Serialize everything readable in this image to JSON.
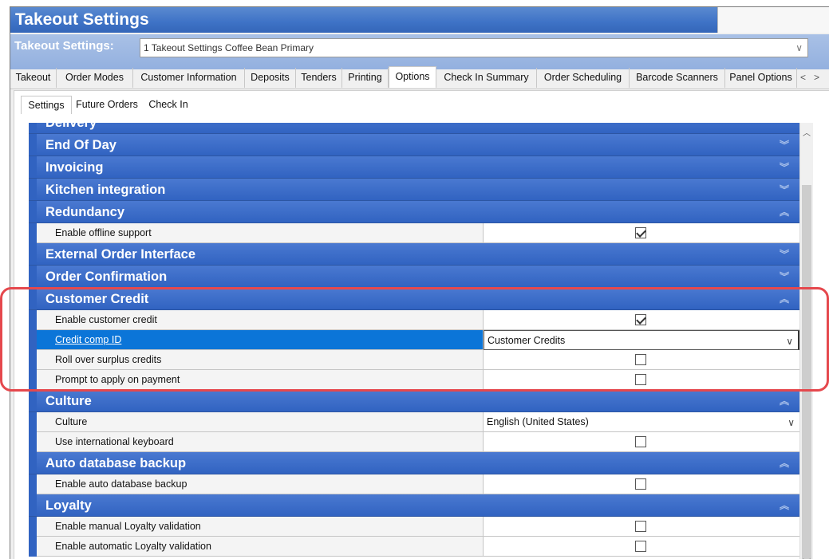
{
  "window": {
    "title": "Takeout Settings"
  },
  "selector": {
    "label": "Takeout Settings:",
    "value": "1 Takeout Settings Coffee Bean Primary"
  },
  "tabs": [
    "Takeout",
    "Order Modes",
    "Customer Information",
    "Deposits",
    "Tenders",
    "Printing",
    "Options",
    "Check In Summary",
    "Order Scheduling",
    "Barcode Scanners",
    "Panel Options"
  ],
  "active_tab": "Options",
  "tab_scroll": {
    "left": "<",
    "right": ">"
  },
  "subtabs": [
    "Settings",
    "Future Orders",
    "Check In"
  ],
  "active_subtab": "Settings",
  "grid": {
    "categories": [
      {
        "name": "Delivery",
        "expanded": false
      },
      {
        "name": "End Of Day",
        "expanded": false
      },
      {
        "name": "Invoicing",
        "expanded": false
      },
      {
        "name": "Kitchen integration",
        "expanded": false
      },
      {
        "name": "Redundancy",
        "expanded": true,
        "props": [
          {
            "label": "Enable offline support",
            "type": "checkbox",
            "checked": true
          }
        ]
      },
      {
        "name": "External Order Interface",
        "expanded": false
      },
      {
        "name": "Order Confirmation",
        "expanded": false
      },
      {
        "name": "Customer Credit",
        "expanded": true,
        "props": [
          {
            "label": "Enable customer credit",
            "type": "checkbox",
            "checked": true
          },
          {
            "label": "Credit comp ID",
            "type": "dropdown",
            "value": "Customer Credits",
            "selected": true
          },
          {
            "label": "Roll over surplus credits",
            "type": "checkbox",
            "checked": false
          },
          {
            "label": "Prompt to apply on payment",
            "type": "checkbox",
            "checked": false
          }
        ]
      },
      {
        "name": "Culture",
        "expanded": true,
        "props": [
          {
            "label": "Culture",
            "type": "dropdown",
            "value": "English (United States)"
          },
          {
            "label": "Use international keyboard",
            "type": "checkbox",
            "checked": false
          }
        ]
      },
      {
        "name": "Auto database backup",
        "expanded": true,
        "props": [
          {
            "label": "Enable auto database backup",
            "type": "checkbox",
            "checked": false
          }
        ]
      },
      {
        "name": "Loyalty",
        "expanded": true,
        "props": [
          {
            "label": "Enable manual Loyalty validation",
            "type": "checkbox",
            "checked": false
          },
          {
            "label": "Enable automatic Loyalty validation",
            "type": "checkbox",
            "checked": false
          }
        ]
      }
    ]
  },
  "icons": {
    "collapsed": "double-chevron-down-icon",
    "expanded": "double-chevron-up-icon",
    "dropdown": "chevron-down-icon"
  },
  "colors": {
    "category_bar": "#3163c1",
    "selected_row": "#0b75d8",
    "highlight": "#e5484d"
  }
}
